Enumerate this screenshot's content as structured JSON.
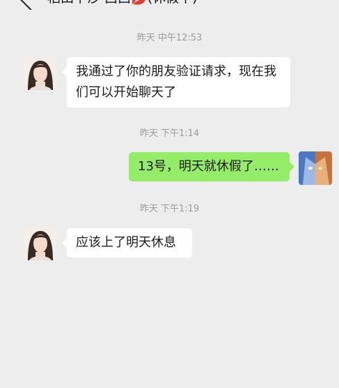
{
  "header": {
    "title": "稻田下沙·西西💋(休假中)",
    "back_icon": "chevron-left-icon",
    "more_icon": "more-icon"
  },
  "messages": [
    {
      "type": "timestamp",
      "text": "昨天 中午12:53"
    },
    {
      "type": "message",
      "sender": "other",
      "text": "我通过了你的朋友验证请求，现在我们可以开始聊天了"
    },
    {
      "type": "timestamp",
      "text": "昨天 下午1:14"
    },
    {
      "type": "message",
      "sender": "me",
      "text": "13号，明天就休假了……"
    },
    {
      "type": "timestamp",
      "text": "昨天 下午1:19"
    },
    {
      "type": "message",
      "sender": "other",
      "text": "应该上了明天休息"
    }
  ],
  "colors": {
    "background": "#ededed",
    "my_bubble": "#95ec69",
    "other_bubble": "#ffffff",
    "timestamp": "#9b9b9b"
  }
}
